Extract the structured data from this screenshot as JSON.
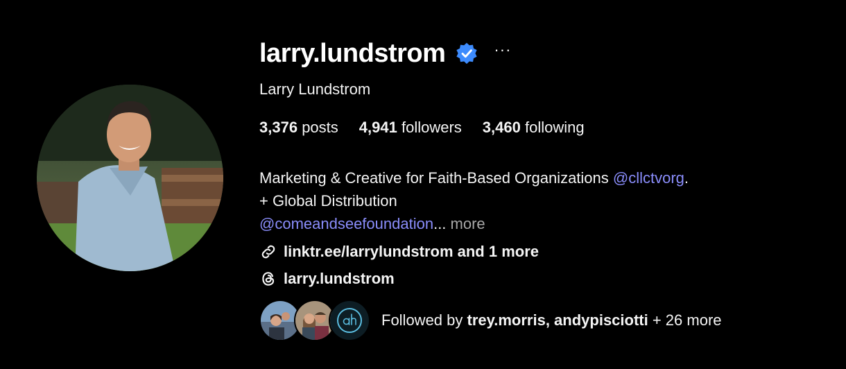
{
  "profile": {
    "username": "larry.lundstrom",
    "full_name": "Larry Lundstrom",
    "verified_icon": "verified-badge-icon",
    "more_options": "···"
  },
  "stats": {
    "posts_count": "3,376",
    "posts_label": "posts",
    "followers_count": "4,941",
    "followers_label": "followers",
    "following_count": "3,460",
    "following_label": "following"
  },
  "bio": {
    "line1_text": "Marketing & Creative for Faith-Based Organizations ",
    "line1_mention": "@cllctvorg",
    "line1_end": ".",
    "line2": "+ Global Distribution",
    "line3_mention": "@comeandseefoundation",
    "ellipsis": "...",
    "more": "more"
  },
  "links": {
    "website": "linktr.ee/larrylundstrom and 1 more",
    "threads": "larry.lundstrom"
  },
  "followed_by": {
    "prefix": "Followed by ",
    "names": "trey.morris, andypisciotti",
    "suffix": " + 26 more"
  },
  "colors": {
    "background": "#000000",
    "mention": "#8a8dfb",
    "verified": "#3d8bfd",
    "muted": "#a8a8a8"
  }
}
